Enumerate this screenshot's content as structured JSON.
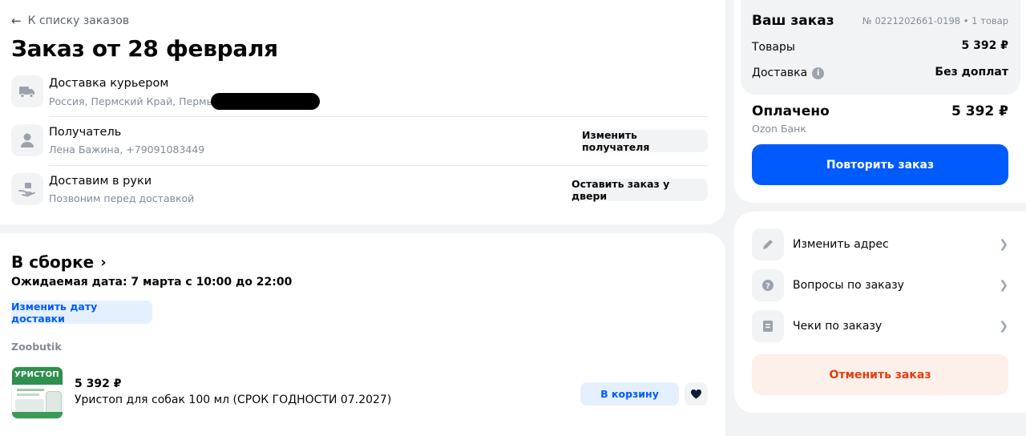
{
  "back_link": {
    "label": "К списку заказов"
  },
  "order_title": "Заказ от 28 февраля",
  "delivery": {
    "title": "Доставка курьером",
    "address": "Россия, Пермский Край, Пермь",
    "icon": "truck-icon"
  },
  "recipient": {
    "title": "Получатель",
    "details": "Лена Бажина, +79091083449",
    "button": "Изменить получателя",
    "icon": "person-icon"
  },
  "handover": {
    "title": "Доставим в руки",
    "subtitle": "Позвоним перед доставкой",
    "button": "Оставить заказ у двери",
    "icon": "hand-box-icon"
  },
  "shipment": {
    "status": "В сборке",
    "expected": "Ожидаемая дата: 7 марта с 10:00 до 22:00",
    "change_date_button": "Изменить дату доставки",
    "seller": "Zoobutik"
  },
  "product": {
    "price": "5 392 ₽",
    "name": "Уристоп для собак 100 мл (СРОК ГОДНОСТИ 07.2027)",
    "cart_button": "В корзину",
    "image_text": "УРИСТОП",
    "favorite_icon": "heart-icon"
  },
  "summary": {
    "title": "Ваш заказ",
    "order_meta": "№ 0221202661-0198 • 1 товар",
    "goods_label": "Товары",
    "goods_value": "5 392 ₽",
    "delivery_label": "Доставка",
    "delivery_value": "Без доплат",
    "paid_label": "Оплачено",
    "paid_value": "5 392 ₽",
    "payment_method": "Ozon Банк",
    "repeat_button": "Повторить заказ"
  },
  "actions": {
    "change_address": "Изменить адрес",
    "questions": "Вопросы по заказу",
    "receipts": "Чеки по заказу",
    "cancel": "Отменить заказ"
  },
  "colors": {
    "primary": "#005bff",
    "cancel_bg": "#fdefe9",
    "cancel_text": "#e63d0f",
    "soft_blue_bg": "#e5f0ff",
    "soft_blue_text": "#005bff",
    "page_bg": "#f2f3f5"
  }
}
